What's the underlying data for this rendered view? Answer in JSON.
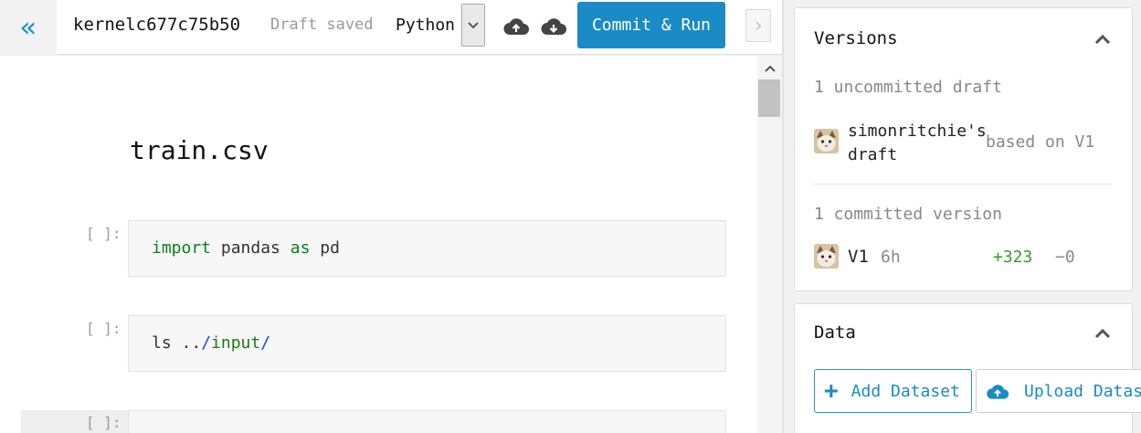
{
  "header": {
    "kernel_title": "kernelc677c75b50",
    "draft_status": "Draft saved",
    "language": "Python",
    "commit_label": "Commit & Run"
  },
  "notebook": {
    "heading": "train.csv",
    "cells": [
      {
        "prompt": "[ ]:",
        "tokens": [
          {
            "text": "import",
            "type": "kw"
          },
          {
            "text": " pandas ",
            "type": "plain"
          },
          {
            "text": "as",
            "type": "kw"
          },
          {
            "text": " pd",
            "type": "plain"
          }
        ]
      },
      {
        "prompt": "[ ]:",
        "tokens": [
          {
            "text": "ls ",
            "type": "plain"
          },
          {
            "text": "..",
            "type": "plain"
          },
          {
            "text": "/",
            "type": "path-slash"
          },
          {
            "text": "input",
            "type": "path-dir"
          },
          {
            "text": "/",
            "type": "path-slash"
          }
        ]
      },
      {
        "prompt": "[ ]:"
      }
    ]
  },
  "versions": {
    "title": "Versions",
    "uncommitted_label": "1 uncommitted draft",
    "draft_owner_line1": "simonritchie's",
    "draft_owner_line2": "draft",
    "draft_based_on": "based on V1",
    "committed_label": "1 committed version",
    "version_name": "V1",
    "version_age": "6h",
    "additions": "+323",
    "deletions": "−0"
  },
  "data": {
    "title": "Data",
    "add_dataset_label": "Add Dataset",
    "upload_dataset_label": "Upload Dataset"
  },
  "colors": {
    "accent": "#1a8bc4",
    "additions": "#3a9a2a",
    "muted": "#888888"
  }
}
